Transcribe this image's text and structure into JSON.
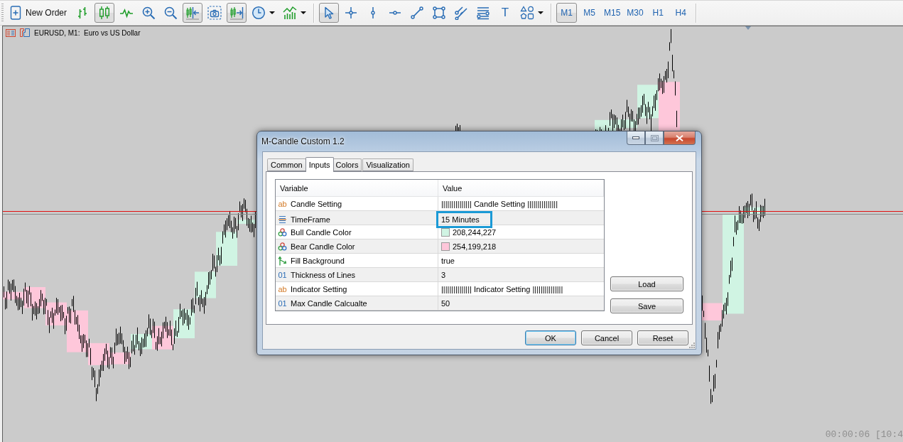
{
  "toolbar": {
    "new_order": {
      "label": "New Order"
    },
    "chart_tools": [
      {
        "pressed": false,
        "has_menu": false
      },
      {
        "pressed": true,
        "has_menu": false
      },
      {
        "pressed": false,
        "has_menu": false
      },
      {
        "pressed": false,
        "has_menu": false
      },
      {
        "pressed": false,
        "has_menu": false
      },
      {
        "pressed": true,
        "has_menu": false
      },
      {
        "pressed": false,
        "has_menu": false
      },
      {
        "pressed": true,
        "has_menu": false
      },
      {
        "pressed": false,
        "has_menu": true
      },
      {
        "pressed": false,
        "has_menu": true
      }
    ],
    "drawing_tools": [
      {
        "pressed": true,
        "has_menu": false
      },
      {
        "pressed": false,
        "has_menu": false
      },
      {
        "pressed": false,
        "has_menu": false
      },
      {
        "pressed": false,
        "has_menu": false
      },
      {
        "pressed": false,
        "has_menu": false
      },
      {
        "pressed": false,
        "has_menu": false
      },
      {
        "pressed": false,
        "has_menu": false
      },
      {
        "pressed": false,
        "has_menu": false
      },
      {
        "pressed": false,
        "has_menu": false,
        "glyph": "T"
      },
      {
        "pressed": false,
        "has_menu": true
      }
    ],
    "timeframes": [
      {
        "label": "M1",
        "selected": true
      },
      {
        "label": "M5",
        "selected": false
      },
      {
        "label": "M15",
        "selected": false
      },
      {
        "label": "M30",
        "selected": false
      },
      {
        "label": "H1",
        "selected": false
      },
      {
        "label": "H4",
        "selected": false
      }
    ]
  },
  "chart": {
    "title": "EURUSD, M1:  Euro vs US Dollar",
    "timer": "00:00:06 [10:4"
  },
  "dialog": {
    "title": "M-Candle Custom 1.2",
    "tabs": [
      {
        "label": "Common",
        "selected": false
      },
      {
        "label": "Inputs",
        "selected": true
      },
      {
        "label": "Colors",
        "selected": false
      },
      {
        "label": "Visualization",
        "selected": false
      }
    ],
    "table": {
      "columns": [
        "Variable",
        "Value"
      ],
      "rows": [
        {
          "kind": "text",
          "type_label": "ab",
          "variable": "Candle Setting",
          "value": "||||||||||||||| Candle Setting |||||||||||||||",
          "highlighted": false
        },
        {
          "kind": "enum",
          "variable": "TimeFrame",
          "value": "15 Minutes",
          "highlighted": true
        },
        {
          "kind": "color",
          "variable": "Bull Candle Color",
          "value": "208,244,227",
          "color": "#d0f4e3",
          "highlighted": false
        },
        {
          "kind": "color",
          "variable": "Bear Candle Color",
          "value": "254,199,218",
          "color": "#fec7da",
          "highlighted": false
        },
        {
          "kind": "bool",
          "variable": "Fill Background",
          "value": "true",
          "highlighted": false
        },
        {
          "kind": "int",
          "type_label": "01",
          "variable": "Thickness of Lines",
          "value": "3",
          "highlighted": false
        },
        {
          "kind": "text",
          "type_label": "ab",
          "variable": "Indicator Setting",
          "value": "||||||||||||||| Indicator Setting |||||||||||||||",
          "highlighted": false
        },
        {
          "kind": "int",
          "type_label": "01",
          "variable": "Max Candle Calcualte",
          "value": "50",
          "highlighted": false
        }
      ]
    },
    "side_buttons": [
      "Load",
      "Save"
    ],
    "buttons": [
      {
        "label": "OK",
        "default": true
      },
      {
        "label": "Cancel",
        "default": false
      },
      {
        "label": "Reset",
        "default": false
      }
    ]
  }
}
